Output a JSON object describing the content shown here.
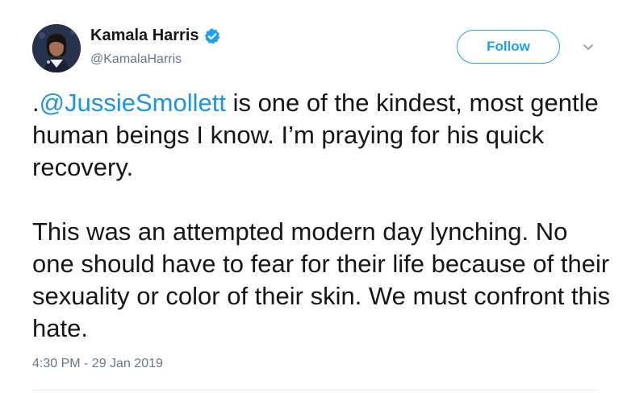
{
  "author": {
    "display_name": "Kamala Harris",
    "handle": "@KamalaHarris",
    "verified": true,
    "avatar_icon": "profile-photo"
  },
  "actions": {
    "follow_label": "Follow",
    "more_icon": "chevron-down-icon"
  },
  "tweet": {
    "para1_prefix": ".",
    "para1_mention": "@JussieSmollett",
    "para1_rest": " is one of the kindest, most gentle human beings I know. I’m praying for his quick recovery.",
    "para2": "This was an attempted modern day lynching. No one should have to fear for their life because of their sexuality or color of their skin. We must confront this hate.",
    "timestamp": "4:30 PM - 29 Jan 2019"
  },
  "colors": {
    "accent": "#1da1f2",
    "mention": "#1b95e0",
    "text": "#14171a",
    "secondary": "#657786"
  }
}
